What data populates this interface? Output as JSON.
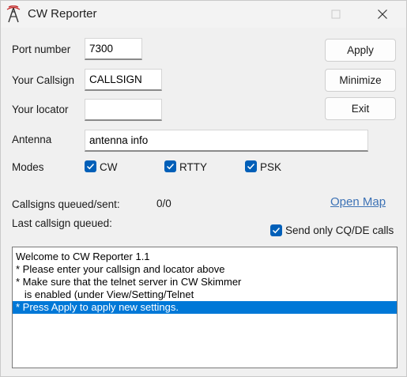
{
  "window": {
    "title": "CW Reporter",
    "icon": "antenna-icon"
  },
  "titlebar": {
    "maximize_icon": "maximize-icon",
    "close_icon": "close-icon"
  },
  "form": {
    "port_label": "Port number",
    "port_value": "7300",
    "callsign_label": "Your Callsign",
    "callsign_value": "CALLSIGN",
    "locator_label": "Your locator",
    "locator_value": "",
    "antenna_label": "Antenna",
    "antenna_value": "antenna info",
    "modes_label": "Modes"
  },
  "modes": [
    {
      "label": "CW",
      "checked": true
    },
    {
      "label": "RTTY",
      "checked": true
    },
    {
      "label": "PSK",
      "checked": true
    }
  ],
  "buttons": {
    "apply": "Apply",
    "minimize": "Minimize",
    "exit": "Exit"
  },
  "status": {
    "queued_sent_label": "Callsigns queued/sent:",
    "queued_sent_value": "0/0",
    "last_callsign_label": "Last callsign queued:",
    "last_callsign_value": "",
    "open_map_link": "Open Map",
    "send_only_label": "Send only CQ/DE calls",
    "send_only_checked": true
  },
  "log": {
    "lines": [
      "Welcome to CW Reporter 1.1",
      "* Please enter your callsign and locator above",
      "* Make sure that the telnet server in CW Skimmer",
      "   is enabled (under View/Setting/Telnet",
      "* Press Apply to apply new settings."
    ],
    "selected_index": 4
  },
  "colors": {
    "accent": "#005fb8",
    "selection": "#0078d7",
    "link": "#3d72b5"
  }
}
